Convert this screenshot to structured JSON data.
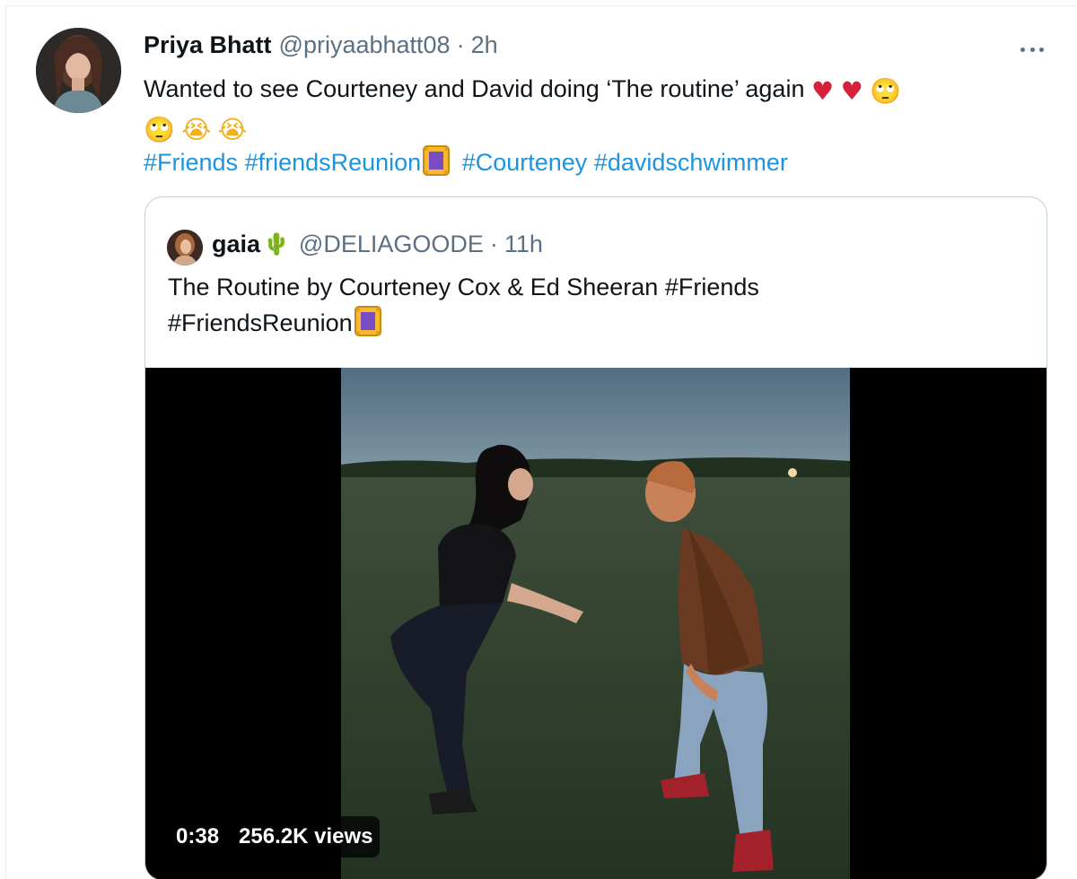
{
  "tweet": {
    "author_name": "Priya Bhatt",
    "handle": "@priyaabhatt08",
    "separator": "·",
    "time": "2h",
    "text_main": "Wanted to see Courteney and David doing ‘The routine’ again",
    "emojis": {
      "heart": "♥",
      "eye_roll": "🙄",
      "crying": "😭"
    },
    "hashtags": [
      "#Friends",
      "#friendsReunion",
      "#Courteney",
      "#davidschwimmer"
    ],
    "more_icon": "more-horizontal-icon"
  },
  "quoted_tweet": {
    "author_name": "gaia",
    "name_emoji": "🌵",
    "handle": "@DELIAGOODE",
    "separator": "·",
    "time": "11h",
    "text": "The Routine by Courteney Cox & Ed Sheeran",
    "hashtags": [
      "#Friends",
      "#FriendsReunion"
    ],
    "video": {
      "duration": "0:38",
      "views": "256.2K views"
    }
  },
  "colors": {
    "link": "#1b95e0",
    "secondary_text": "#5b7083",
    "border": "#c4cfd6",
    "heart": "#d6203a"
  }
}
